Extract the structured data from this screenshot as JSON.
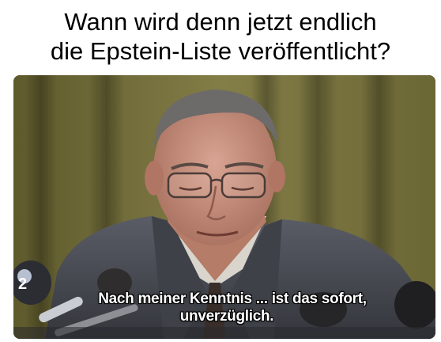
{
  "meme": {
    "caption_lines": [
      "Wann wird denn jetzt endlich",
      "die Epstein-Liste veröffentlicht?"
    ],
    "subtitle_lines": [
      "Nach meiner Kenntnis ... ist das sofort,",
      "unverzüglich."
    ],
    "channel_logo": "2"
  },
  "colors": {
    "background": "#ffffff",
    "curtain": "#7a7540",
    "suit": "#4a4d55",
    "subtitle_text": "#ffffff"
  }
}
